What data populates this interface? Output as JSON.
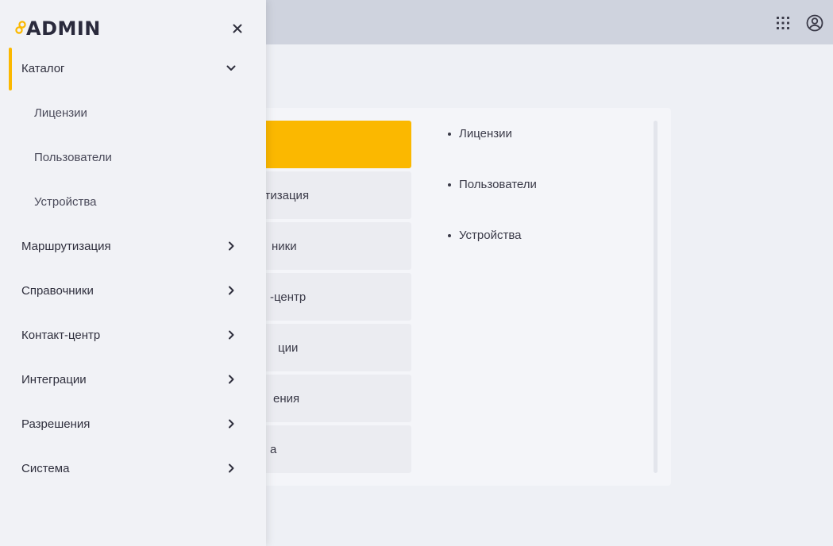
{
  "brand": {
    "logo_text": "ADMIN",
    "accent_color": "#fbb800"
  },
  "header": {
    "apps_icon": "grid-icon",
    "profile_icon": "user-circle-icon"
  },
  "sidebar": {
    "close_icon": "close-icon",
    "items": [
      {
        "label": "Каталог",
        "expanded": true,
        "children": [
          {
            "label": "Лицензии"
          },
          {
            "label": "Пользователи"
          },
          {
            "label": "Устройства"
          }
        ]
      },
      {
        "label": "Маршрутизация",
        "expanded": false
      },
      {
        "label": "Справочники",
        "expanded": false
      },
      {
        "label": "Контакт-центр",
        "expanded": false
      },
      {
        "label": "Интеграции",
        "expanded": false
      },
      {
        "label": "Разрешения",
        "expanded": false
      },
      {
        "label": "Система",
        "expanded": false
      }
    ]
  },
  "main": {
    "menu_tiles": [
      {
        "label": "",
        "active": true
      },
      {
        "label": "утизация",
        "active": false
      },
      {
        "label": "ники",
        "active": false
      },
      {
        "label": "-центр",
        "active": false
      },
      {
        "label": "ции",
        "active": false
      },
      {
        "label": "ения",
        "active": false
      },
      {
        "label": "а",
        "active": false
      }
    ],
    "sub_items": [
      {
        "label": "Лицензии"
      },
      {
        "label": "Пользователи"
      },
      {
        "label": "Устройства"
      }
    ]
  }
}
